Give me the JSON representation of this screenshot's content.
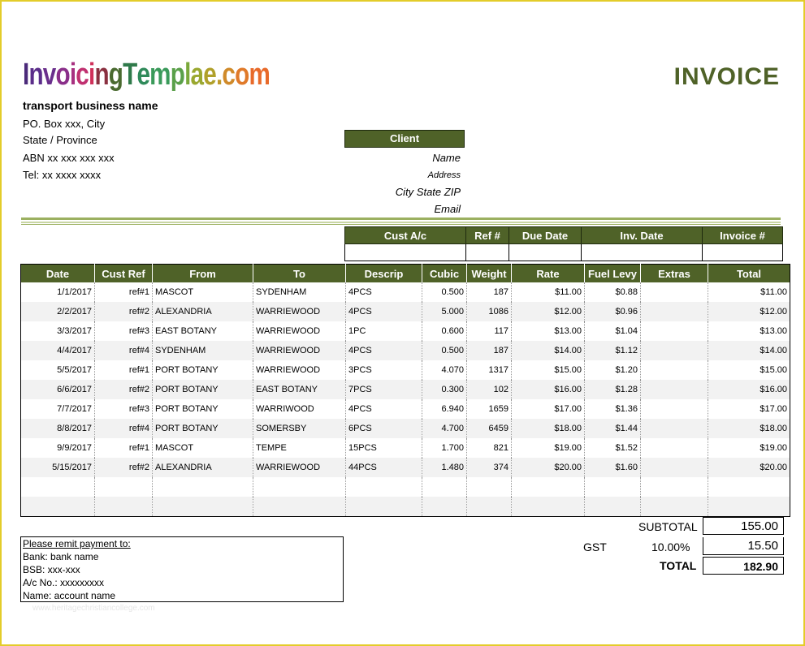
{
  "logo": {
    "text": "InvoicingTemplae.com",
    "letters": [
      {
        "ch": "I",
        "color": "#4b2a7a"
      },
      {
        "ch": "n",
        "color": "#5b2d8a"
      },
      {
        "ch": "v",
        "color": "#6a2f8c"
      },
      {
        "ch": "o",
        "color": "#8a2f8a"
      },
      {
        "ch": "i",
        "color": "#a83080"
      },
      {
        "ch": "c",
        "color": "#c03070"
      },
      {
        "ch": "i",
        "color": "#d0305a"
      },
      {
        "ch": "n",
        "color": "#8a3040"
      },
      {
        "ch": "g",
        "color": "#4a6a30"
      },
      {
        "ch": "T",
        "color": "#2f7a4a"
      },
      {
        "ch": "e",
        "color": "#2f8a5a"
      },
      {
        "ch": "m",
        "color": "#3a9a5a"
      },
      {
        "ch": "p",
        "color": "#5aa04a"
      },
      {
        "ch": "l",
        "color": "#7aa83a"
      },
      {
        "ch": "a",
        "color": "#9aa830"
      },
      {
        "ch": "e",
        "color": "#b0a02a"
      },
      {
        "ch": ".",
        "color": "#c09a2a"
      },
      {
        "ch": "c",
        "color": "#d08a2a"
      },
      {
        "ch": "o",
        "color": "#e07a2a"
      },
      {
        "ch": "m",
        "color": "#e86a2a"
      }
    ]
  },
  "title": "INVOICE",
  "business": {
    "name": "transport business name",
    "address1": "PO. Box xxx, City",
    "address2": "State / Province",
    "abn": "ABN xx xxx xxx xxx",
    "tel": "Tel: xx xxxx xxxx"
  },
  "client": {
    "heading": "Client",
    "name": "Name",
    "address": "Address",
    "city": "City State ZIP",
    "email": "Email"
  },
  "info_headers": [
    "Cust A/c",
    "Ref #",
    "Due Date",
    "Inv. Date",
    "Invoice #"
  ],
  "columns": [
    "Date",
    "Cust Ref",
    "From",
    "To",
    "Descrip",
    "Cubic",
    "Weight",
    "Rate",
    "Fuel Levy",
    "Extras",
    "Total"
  ],
  "rows": [
    [
      "1/1/2017",
      "ref#1",
      "MASCOT",
      "SYDENHAM",
      "4PCS",
      "0.500",
      "187",
      "$11.00",
      "$0.88",
      "",
      "$11.00"
    ],
    [
      "2/2/2017",
      "ref#2",
      "ALEXANDRIA",
      "WARRIEWOOD",
      "4PCS",
      "5.000",
      "1086",
      "$12.00",
      "$0.96",
      "",
      "$12.00"
    ],
    [
      "3/3/2017",
      "ref#3",
      "EAST BOTANY",
      "WARRIEWOOD",
      "1PC",
      "0.600",
      "117",
      "$13.00",
      "$1.04",
      "",
      "$13.00"
    ],
    [
      "4/4/2017",
      "ref#4",
      "SYDENHAM",
      "WARRIEWOOD",
      "4PCS",
      "0.500",
      "187",
      "$14.00",
      "$1.12",
      "",
      "$14.00"
    ],
    [
      "5/5/2017",
      "ref#1",
      "PORT BOTANY",
      "WARRIEWOOD",
      "3PCS",
      "4.070",
      "1317",
      "$15.00",
      "$1.20",
      "",
      "$15.00"
    ],
    [
      "6/6/2017",
      "ref#2",
      "PORT BOTANY",
      "EAST BOTANY",
      "7PCS",
      "0.300",
      "102",
      "$16.00",
      "$1.28",
      "",
      "$16.00"
    ],
    [
      "7/7/2017",
      "ref#3",
      "PORT BOTANY",
      "WARRIWOOD",
      "4PCS",
      "6.940",
      "1659",
      "$17.00",
      "$1.36",
      "",
      "$17.00"
    ],
    [
      "8/8/2017",
      "ref#4",
      "PORT BOTANY",
      "SOMERSBY",
      "6PCS",
      "4.700",
      "6459",
      "$18.00",
      "$1.44",
      "",
      "$18.00"
    ],
    [
      "9/9/2017",
      "ref#1",
      "MASCOT",
      "TEMPE",
      "15PCS",
      "1.700",
      "821",
      "$19.00",
      "$1.52",
      "",
      "$19.00"
    ],
    [
      "5/15/2017",
      "ref#2",
      "ALEXANDRIA",
      "WARRIEWOOD",
      "44PCS",
      "1.480",
      "374",
      "$20.00",
      "$1.60",
      "",
      "$20.00"
    ],
    [
      "",
      "",
      "",
      "",
      "",
      "",
      "",
      "",
      "",
      "",
      ""
    ],
    [
      "",
      "",
      "",
      "",
      "",
      "",
      "",
      "",
      "",
      "",
      ""
    ]
  ],
  "totals": {
    "subtotal_label": "SUBTOTAL",
    "subtotal": "155.00",
    "gst_label": "GST",
    "gst_rate": "10.00%",
    "gst": "15.50",
    "total_label": "TOTAL",
    "total": "182.90"
  },
  "remit": {
    "heading": "Please remit payment to:",
    "bank": "Bank: bank name",
    "bsb": "BSB: xxx-xxx",
    "acno": "A/c No.: xxxxxxxxx",
    "acname": "Name: account name"
  },
  "watermark": "www.heritagechristiancollege.com",
  "colors": {
    "accent": "#4f6228",
    "frame": "#e3cc2a"
  }
}
